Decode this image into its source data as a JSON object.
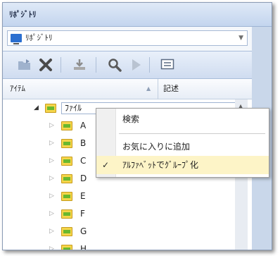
{
  "panel": {
    "title": "ﾘﾎﾟｼﾞﾄﾘ"
  },
  "selector": {
    "value": "ﾘﾎﾟｼﾞﾄﾘ",
    "icon": "monitor-icon"
  },
  "toolbar": {
    "icons": [
      "import-folder-icon",
      "delete-icon",
      "download-icon",
      "search-icon",
      "play-icon",
      "properties-icon"
    ]
  },
  "columns": {
    "item": "ｱｲﾃﾑ",
    "description": "記述"
  },
  "tree": {
    "root": {
      "label": "ﾌｧｲﾙ",
      "expanded": true
    },
    "children": [
      "A",
      "B",
      "C",
      "D",
      "E",
      "F",
      "G",
      "H"
    ]
  },
  "context_menu": {
    "items": [
      {
        "label": "検索",
        "checked": false
      },
      {
        "label": "お気に入りに追加",
        "checked": false
      },
      {
        "label": "ｱﾙﾌｧﾍﾞｯﾄでｸﾞﾙｰﾌﾟ化",
        "checked": true
      }
    ],
    "check_glyph": "✓"
  },
  "colors": {
    "header_bg": "#c3d5ee",
    "folder": "#f5d54a",
    "checked_bg": "#fdf4c7"
  }
}
